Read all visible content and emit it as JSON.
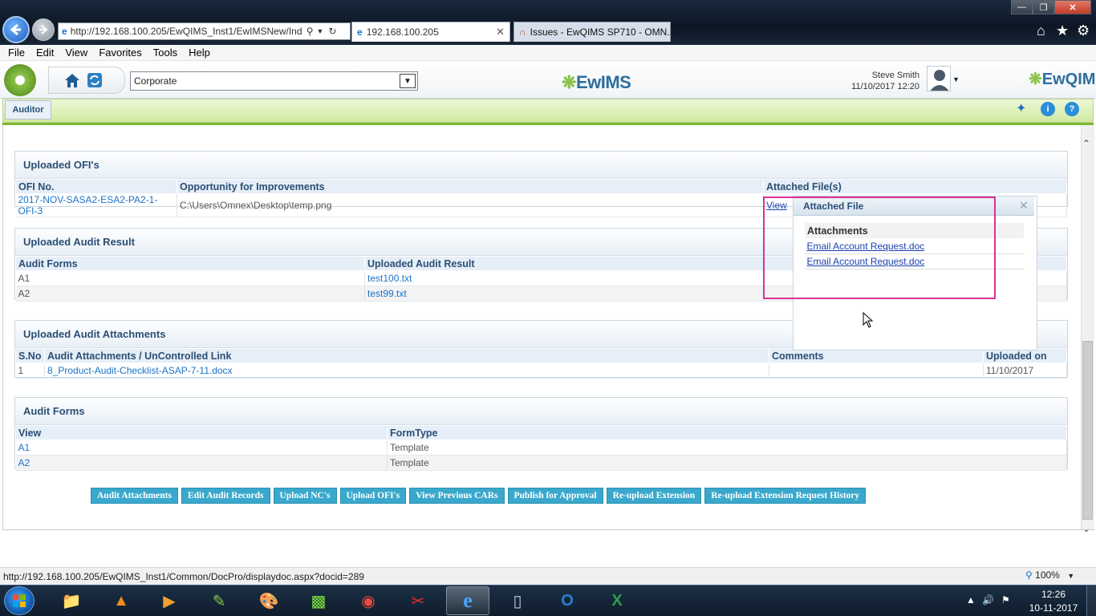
{
  "browser": {
    "address": "http://192.168.100.205/EwQIMS_Inst1/EwIMSNew/Ind",
    "tabs": [
      {
        "label": "192.168.100.205"
      },
      {
        "label": "Issues - EwQIMS SP710 - OMN..."
      }
    ],
    "menu": [
      "File",
      "Edit",
      "View",
      "Favorites",
      "Tools",
      "Help"
    ],
    "status_url": "http://192.168.100.205/EwQIMS_Inst1/Common/DocPro/displaydoc.aspx?docid=289",
    "zoom": "100%"
  },
  "header": {
    "organization": "Corporate",
    "logo_text": "EwIMS",
    "user_name": "Steve Smith",
    "datetime": "11/10/2017 12:20",
    "brand": "EwQIMS"
  },
  "module": {
    "label": "Auditor"
  },
  "ofi": {
    "title": "Uploaded OFI's",
    "columns": [
      "OFI No.",
      "Opportunity for Improvements",
      "Attached File(s)"
    ],
    "rows": [
      {
        "no": "2017-NOV-SASA2-ESA2-PA2-1-OFI-3",
        "opportunity": "C:\\Users\\Omnex\\Desktop\\temp.png",
        "file": "View"
      }
    ]
  },
  "audit_result": {
    "title": "Uploaded Audit Result",
    "columns": [
      "Audit Forms",
      "Uploaded Audit Result"
    ],
    "rows": [
      {
        "form": "A1",
        "result": "test100.txt"
      },
      {
        "form": "A2",
        "result": "test99.txt"
      }
    ]
  },
  "attachments": {
    "title": "Uploaded Audit Attachments",
    "columns": [
      "S.No",
      "Audit Attachments / UnControlled Link",
      "Comments",
      "Uploaded on"
    ],
    "rows": [
      {
        "sno": "1",
        "link": "8_Product-Audit-Checklist-ASAP-7-11.docx",
        "comments": "",
        "date": "11/10/2017"
      }
    ]
  },
  "forms": {
    "title": "Audit Forms",
    "columns": [
      "View",
      "FormType"
    ],
    "rows": [
      {
        "view": "A1",
        "type": "Template"
      },
      {
        "view": "A2",
        "type": "Template"
      }
    ]
  },
  "buttons": {
    "audit_attachments": "Audit Attachments",
    "edit_records": "Edit Audit Records",
    "upload_nc": "Upload NC's",
    "upload_ofi": "Upload OFI's",
    "view_cars": "View Previous CARs",
    "publish": "Publish for Approval",
    "reupload": "Re-upload Extension",
    "reupload_history": "Re-upload Extension Request History"
  },
  "popup": {
    "title": "Attached File",
    "header": "Attachments",
    "files": [
      "Email Account Request.doc",
      "Email Account Request.doc"
    ]
  },
  "taskbar": {
    "time": "12:26",
    "date": "10-11-2017"
  },
  "colors": {
    "accent_button": "#3aa8cc",
    "module_bar": "#cfe9a0",
    "highlight_box": "#d9338f",
    "link": "#1a73c9"
  }
}
